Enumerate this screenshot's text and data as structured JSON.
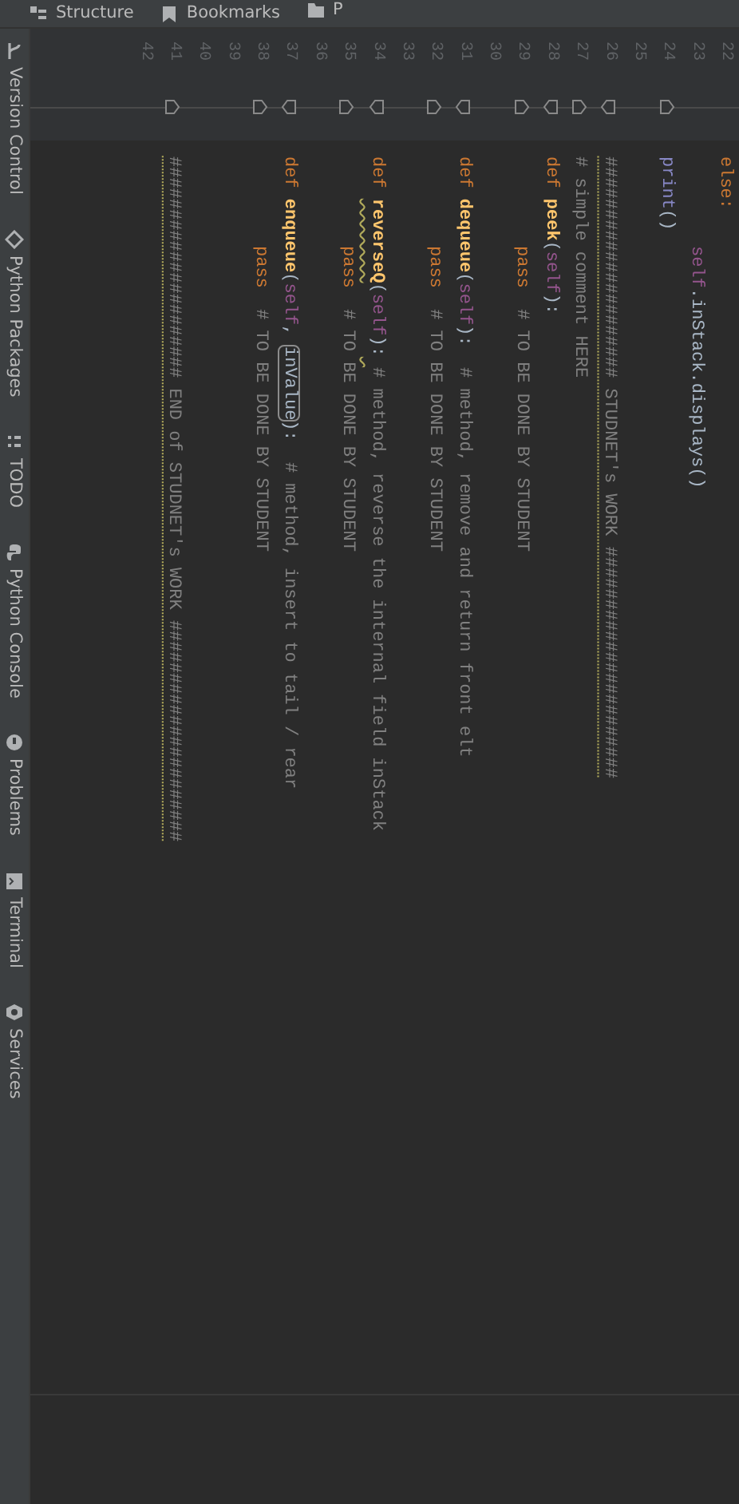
{
  "left_strip": [
    {
      "label": "Structure"
    },
    {
      "label": "Bookmarks"
    },
    {
      "label": "P"
    }
  ],
  "line_numbers": [
    "22",
    "23",
    "24",
    "25",
    "26",
    "27",
    "28",
    "29",
    "30",
    "31",
    "32",
    "33",
    "34",
    "35",
    "36",
    "37",
    "38",
    "39",
    "40",
    "41",
    "42"
  ],
  "code_lines": [
    {
      "kind": "plain",
      "tokens": [
        {
          "text": "else:",
          "kind": "keyword"
        }
      ],
      "children": [
        {
          "kind": "plain",
          "tokens": [
            {
              "text": "self",
              "kind": "self"
            },
            {
              "text": ".inStack.displays()",
              "kind": "plain"
            }
          ]
        }
      ]
    },
    {
      "kind": "fold_end",
      "tokens": [
        {
          "text": "print",
          "kind": "builtin"
        },
        {
          "text": "()",
          "kind": "plain"
        }
      ]
    },
    {
      "kind": "blank"
    },
    {
      "kind": "fold_start",
      "tokens": [
        {
          "text": "##################### STUDNET's WORK ######################",
          "kind": "comment_dotted"
        }
      ]
    },
    {
      "kind": "fold_end",
      "tokens": [
        {
          "text": "# simple comment HERE",
          "kind": "comment"
        }
      ]
    },
    {
      "kind": "fold_start",
      "tokens": [
        {
          "text": "def ",
          "kind": "keyword"
        },
        {
          "text": "peek",
          "kind": "funcname"
        },
        {
          "text": "(",
          "kind": "plain"
        },
        {
          "text": "self",
          "kind": "self"
        },
        {
          "text": "):",
          "kind": "plain"
        }
      ],
      "children": [
        {
          "kind": "fold_end",
          "tokens": [
            {
              "text": "pass",
              "kind": "keyword"
            },
            {
              "text": "  # TO BE DONE BY STUDENT",
              "kind": "comment"
            }
          ]
        }
      ]
    },
    {
      "kind": "blank"
    },
    {
      "kind": "fold_start",
      "tokens": [
        {
          "text": "def ",
          "kind": "keyword"
        },
        {
          "text": "dequeue",
          "kind": "funcname"
        },
        {
          "text": "(",
          "kind": "plain"
        },
        {
          "text": "self",
          "kind": "self"
        },
        {
          "text": "):",
          "kind": "plain"
        },
        {
          "text": "  # method, remove and return front elt",
          "kind": "comment"
        }
      ],
      "children": [
        {
          "kind": "fold_end",
          "tokens": [
            {
              "text": "pass",
              "kind": "keyword"
            },
            {
              "text": "  # TO BE DONE BY STUDENT",
              "kind": "comment"
            }
          ]
        }
      ]
    },
    {
      "kind": "blank"
    },
    {
      "kind": "fold_start",
      "tokens": [
        {
          "text": "def ",
          "kind": "keyword"
        },
        {
          "text": "reverseQ",
          "kind": "funcname_warned"
        },
        {
          "text": "(",
          "kind": "plain"
        },
        {
          "text": "self",
          "kind": "self"
        },
        {
          "text": "):",
          "kind": "plain"
        },
        {
          "text": " # method, reverse the internal field inStack",
          "kind": "comment_warned"
        }
      ],
      "children": [
        {
          "kind": "fold_end",
          "tokens": [
            {
              "text": "pass",
              "kind": "keyword"
            },
            {
              "text": "  # TO BE DONE BY STUDENT",
              "kind": "comment"
            }
          ]
        }
      ]
    },
    {
      "kind": "blank"
    },
    {
      "kind": "fold_start",
      "tokens": [
        {
          "text": "def ",
          "kind": "keyword"
        },
        {
          "text": "enqueue",
          "kind": "funcname"
        },
        {
          "text": "(",
          "kind": "plain"
        },
        {
          "text": "self",
          "kind": "self"
        },
        {
          "text": ", ",
          "kind": "plain"
        },
        {
          "text": "inValue",
          "kind": "plain_boxed"
        },
        {
          "text": "):",
          "kind": "plain"
        },
        {
          "text": "  # method, insert to tail / rear",
          "kind": "comment"
        }
      ],
      "children": [
        {
          "kind": "fold_end",
          "tokens": [
            {
              "text": "pass",
              "kind": "keyword"
            },
            {
              "text": "  # TO BE DONE BY STUDENT",
              "kind": "comment"
            }
          ]
        }
      ]
    },
    {
      "kind": "blank"
    },
    {
      "kind": "blank"
    },
    {
      "kind": "fold_end",
      "tokens": [
        {
          "text": "##################### END of STUDNET's WORK #####################",
          "kind": "comment_dotted"
        }
      ]
    },
    {
      "kind": "blank"
    }
  ],
  "bottom_strip": [
    {
      "label": "Version Control"
    },
    {
      "label": "Python Packages"
    },
    {
      "label": "TODO"
    },
    {
      "label": "Python Console"
    },
    {
      "label": "Problems"
    },
    {
      "label": "Terminal"
    },
    {
      "label": "Services"
    }
  ]
}
